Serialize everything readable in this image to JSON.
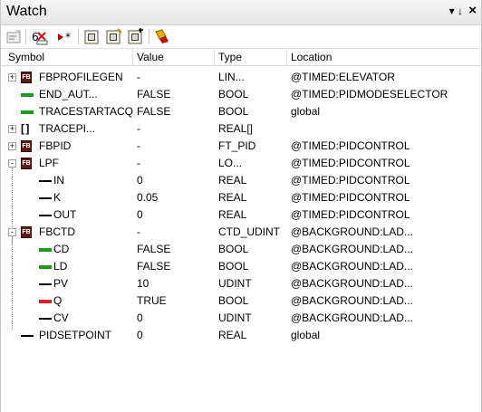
{
  "window": {
    "title": "Watch",
    "pin_glyph": "▾ ↓",
    "close_glyph": "×"
  },
  "toolbar": {
    "buttons": [
      "properties-icon",
      "insert-variable-icon",
      "force-value-icon",
      "watch-list-icon",
      "watch-list-add-icon",
      "watch-list-remove-icon",
      "trace-icon"
    ]
  },
  "columns": {
    "symbol": "Symbol",
    "value": "Value",
    "type": "Type",
    "location": "Location"
  },
  "rows": [
    {
      "symbol": "FBPROFILEGEN",
      "value": "-",
      "type": "LIN...",
      "location": "@TIMED:ELEVATOR",
      "icon": "fb",
      "expander": "+"
    },
    {
      "symbol": "END_AUT...",
      "value": "FALSE",
      "type": "BOOL",
      "location": "@TIMED:PIDMODESELECTOR",
      "icon": "green"
    },
    {
      "symbol": "TRACESTARTACQ",
      "value": "FALSE",
      "type": "BOOL",
      "location": "global",
      "icon": "green"
    },
    {
      "symbol": "TRACEPI...",
      "value": "-",
      "type": "REAL[]",
      "location": "",
      "icon": "array",
      "expander": "+"
    },
    {
      "symbol": "FBPID",
      "value": "-",
      "type": "FT_PID",
      "location": "@TIMED:PIDCONTROL",
      "icon": "fb",
      "expander": "+"
    },
    {
      "symbol": "LPF",
      "value": "-",
      "type": "LO...",
      "location": "@TIMED:PIDCONTROL",
      "icon": "fb",
      "expander": "-"
    },
    {
      "symbol": "IN",
      "value": "0",
      "type": "REAL",
      "location": "@TIMED:PIDCONTROL",
      "icon": "black"
    },
    {
      "symbol": "K",
      "value": "0.05",
      "type": "REAL",
      "location": "@TIMED:PIDCONTROL",
      "icon": "black"
    },
    {
      "symbol": "OUT",
      "value": "0",
      "type": "REAL",
      "location": "@TIMED:PIDCONTROL",
      "icon": "black"
    },
    {
      "symbol": "FBCTD",
      "value": "-",
      "type": "CTD_UDINT",
      "location": "@BACKGROUND:LAD...",
      "icon": "fb",
      "expander": "-"
    },
    {
      "symbol": "CD",
      "value": "FALSE",
      "type": "BOOL",
      "location": "@BACKGROUND:LAD...",
      "icon": "green"
    },
    {
      "symbol": "LD",
      "value": "FALSE",
      "type": "BOOL",
      "location": "@BACKGROUND:LAD...",
      "icon": "green"
    },
    {
      "symbol": "PV",
      "value": "10",
      "type": "UDINT",
      "location": "@BACKGROUND:LAD...",
      "icon": "black"
    },
    {
      "symbol": "Q",
      "value": "TRUE",
      "type": "BOOL",
      "location": "@BACKGROUND:LAD...",
      "icon": "red"
    },
    {
      "symbol": "CV",
      "value": "0",
      "type": "UDINT",
      "location": "@BACKGROUND:LAD...",
      "icon": "black"
    },
    {
      "symbol": "PIDSETPOINT",
      "value": "0",
      "type": "REAL",
      "location": "global",
      "icon": "black"
    }
  ],
  "colors": {
    "bool_false": "#1e9a1e",
    "bool_true": "#e02020",
    "fb_icon": "#5a1e14"
  }
}
